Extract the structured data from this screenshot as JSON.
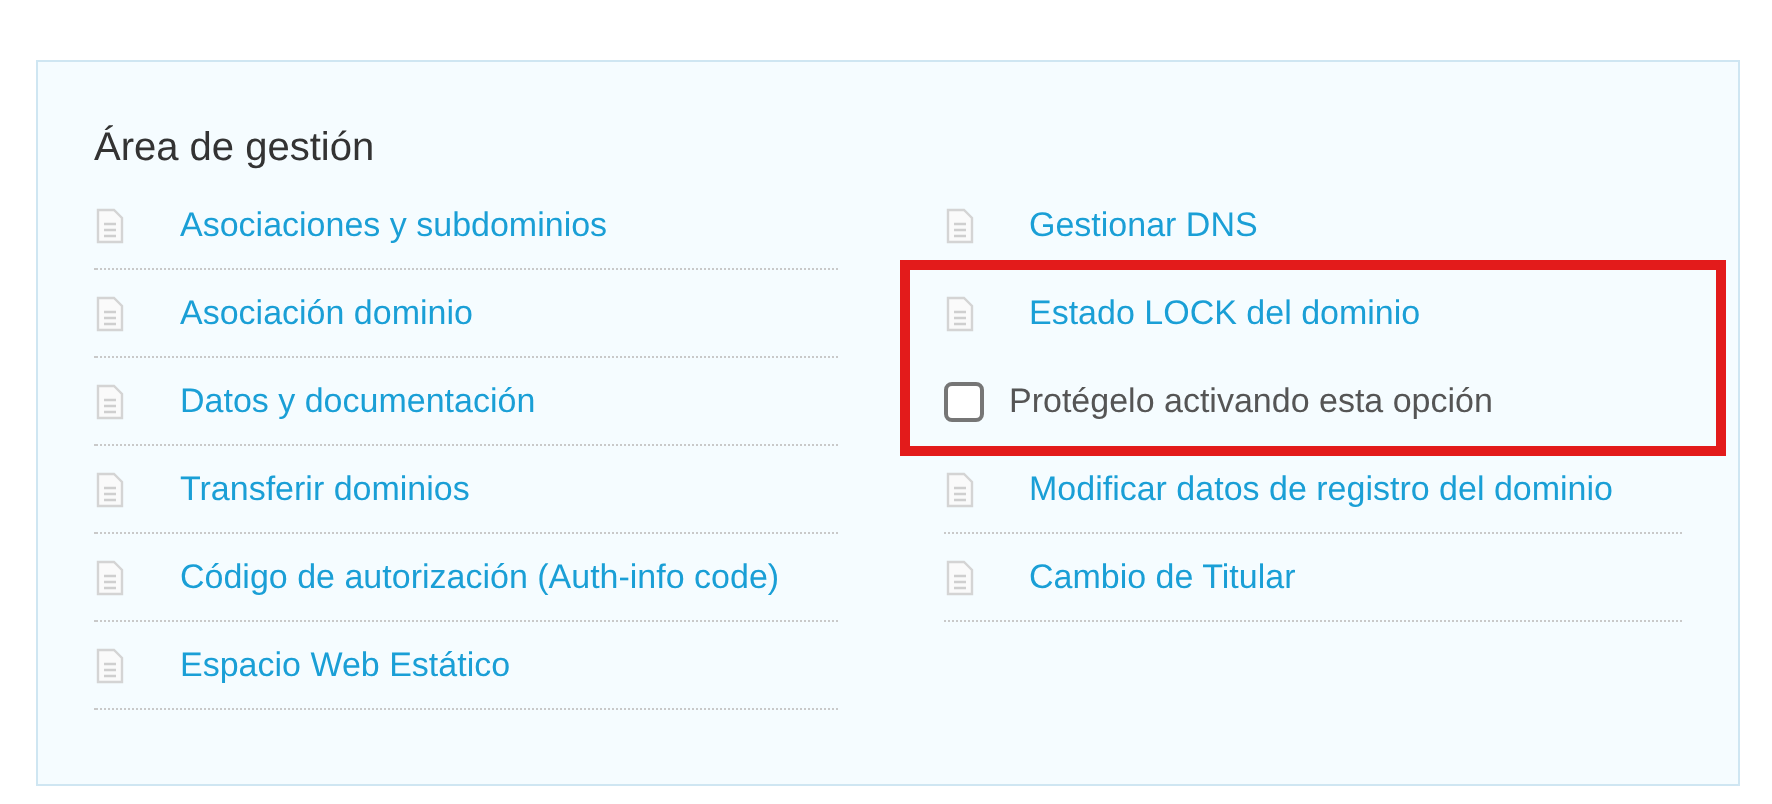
{
  "panel": {
    "title": "Área de gestión",
    "left_column": [
      {
        "kind": "link",
        "label": "Asociaciones y subdominios"
      },
      {
        "kind": "link",
        "label": "Asociación dominio"
      },
      {
        "kind": "link",
        "label": "Datos y documentación"
      },
      {
        "kind": "link",
        "label": "Transferir dominios"
      },
      {
        "kind": "link",
        "label": "Código de autorización (Auth-info code)"
      },
      {
        "kind": "link",
        "label": "Espacio Web Estático"
      }
    ],
    "right_column": [
      {
        "kind": "link",
        "label": "Gestionar DNS"
      },
      {
        "kind": "highlight",
        "items": [
          {
            "kind": "link",
            "label": "Estado LOCK del dominio"
          },
          {
            "kind": "checkbox",
            "label": "Protégelo activando esta opción",
            "checked": false
          }
        ]
      },
      {
        "kind": "link",
        "label": "Modificar datos de registro del dominio"
      },
      {
        "kind": "link",
        "label": "Cambio de Titular"
      }
    ]
  }
}
